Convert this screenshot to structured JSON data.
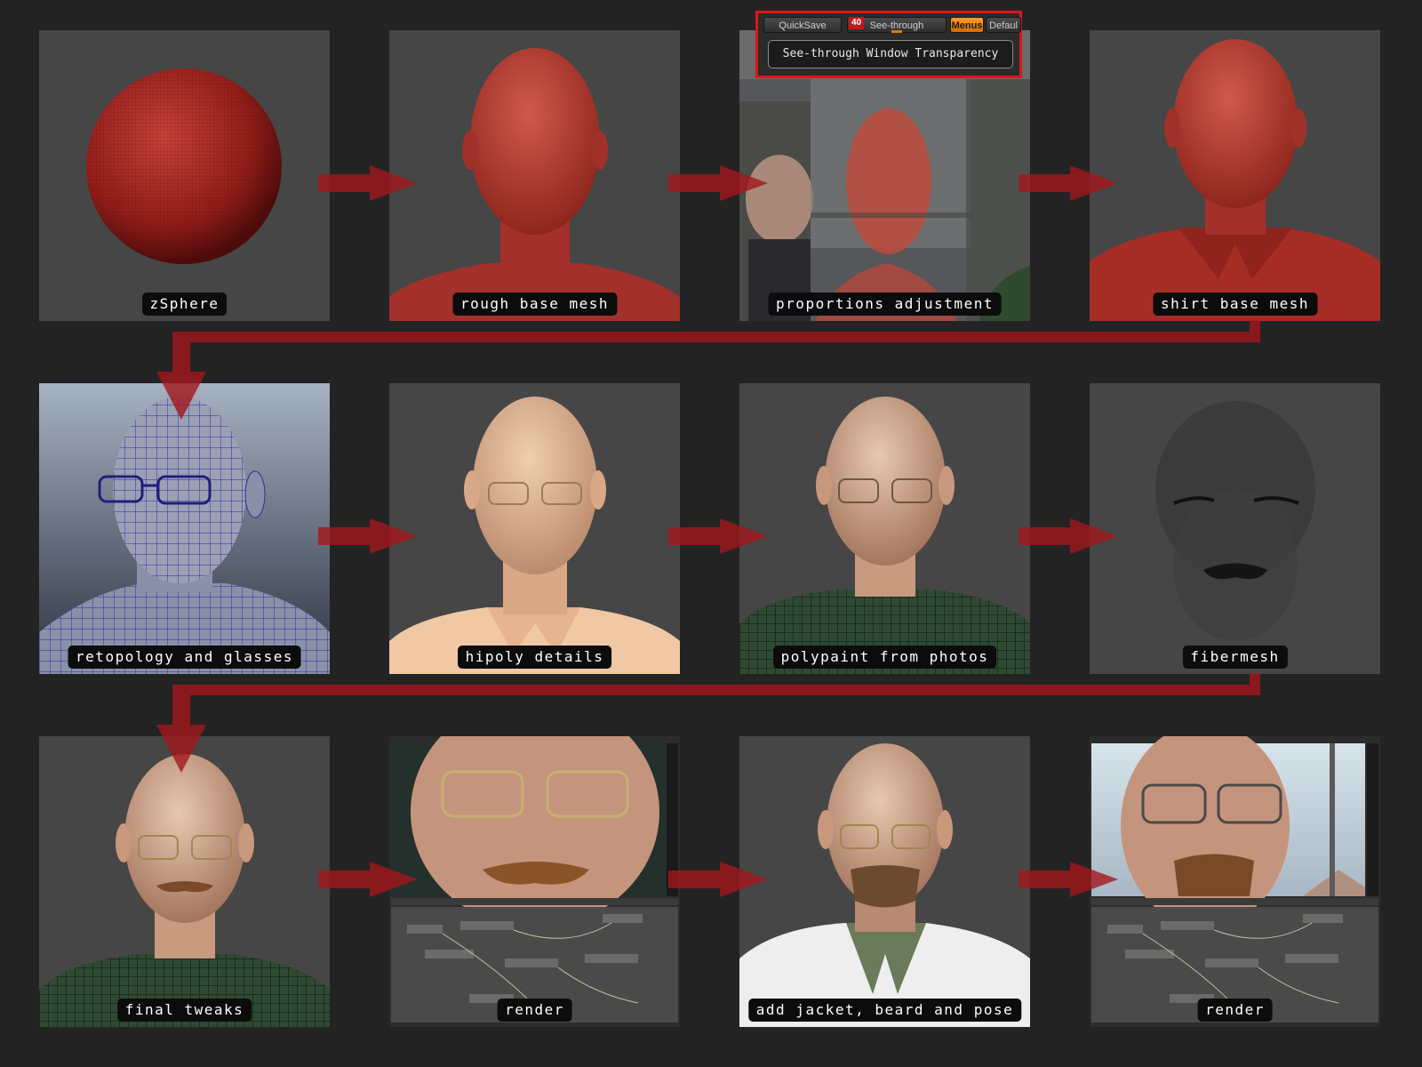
{
  "steps": [
    {
      "label": "zSphere"
    },
    {
      "label": "rough base mesh"
    },
    {
      "label": "proportions adjustment"
    },
    {
      "label": "shirt base mesh"
    },
    {
      "label": "retopology and glasses"
    },
    {
      "label": "hipoly details"
    },
    {
      "label": "polypaint from photos"
    },
    {
      "label": "fibermesh"
    },
    {
      "label": "final tweaks"
    },
    {
      "label": "render"
    },
    {
      "label": "add jacket, beard and pose"
    },
    {
      "label": "render"
    }
  ],
  "zbrush_ui": {
    "quicksave": "QuickSave",
    "see_through": "See-through",
    "see_through_value": "40",
    "menus": "Menus",
    "default": "Defaul",
    "tooltip": "See-through Window Transparency"
  },
  "colors": {
    "background": "#232323",
    "tile": "#464646",
    "arrow": "#a3161c",
    "highlight": "#e0141a",
    "clay": "#b2362c"
  }
}
